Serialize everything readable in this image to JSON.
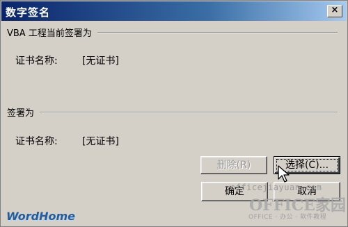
{
  "window": {
    "title": "数字签名",
    "close_label": "×"
  },
  "vba_section": {
    "heading": "VBA 工程当前签署为",
    "cert_label": "证书名称:",
    "cert_value": "[无证书]"
  },
  "signer_section": {
    "heading": "签署为",
    "cert_label": "证书名称:",
    "cert_value": "[无证书]"
  },
  "buttons": {
    "remove": "删除(R)",
    "choose": "选择(C)...",
    "ok": "确定",
    "cancel": "取消"
  },
  "watermarks": {
    "site": "officejiayuan.com",
    "brand": "OFFICE家园",
    "brand_sub": "OFFICE · 办公 · 软件教程",
    "corner": "WordHome"
  }
}
